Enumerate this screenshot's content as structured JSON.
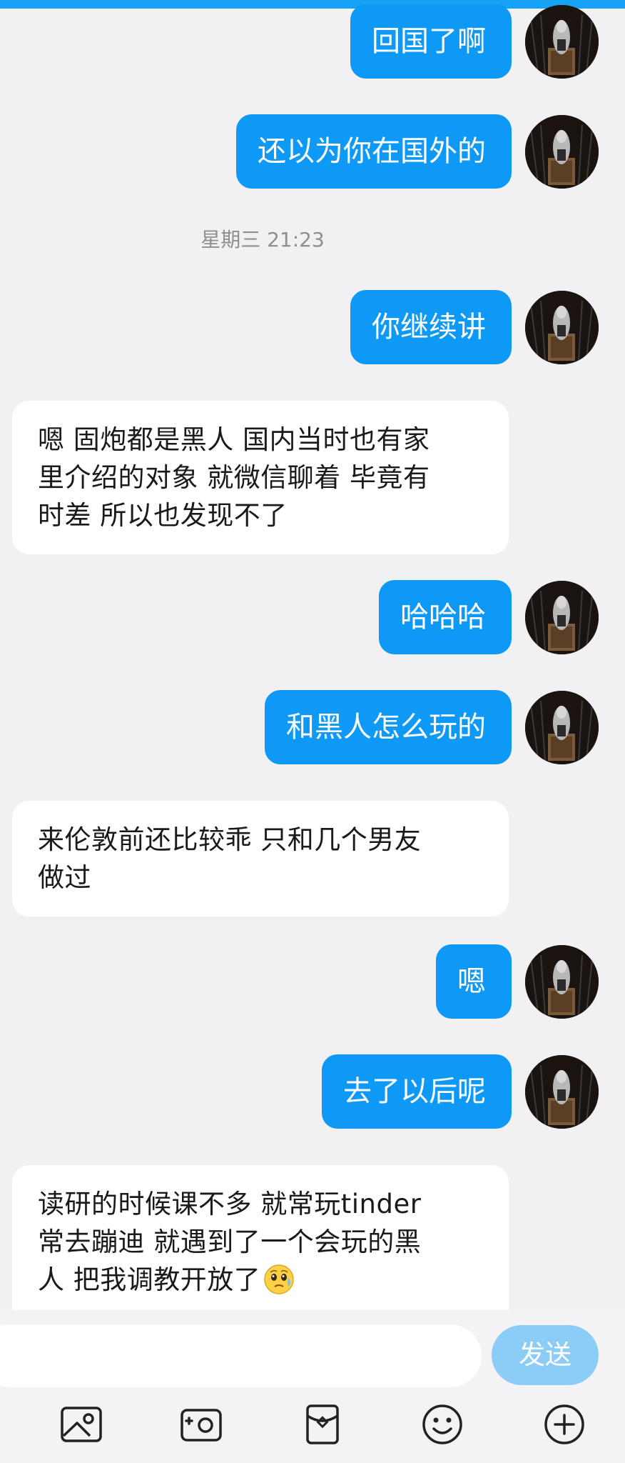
{
  "messages": [
    {
      "id": "m1",
      "direction": "out",
      "text": "回国了啊"
    },
    {
      "id": "m2",
      "direction": "out",
      "text": "还以为你在国外的"
    },
    {
      "id": "m3",
      "direction": "out",
      "text": "你继续讲"
    },
    {
      "id": "m4",
      "direction": "in",
      "lines": [
        "嗯 固炮都是黑人 国内当时也有家",
        "里介绍的对象 就微信聊着 毕竟有",
        "时差 所以也发现不了"
      ]
    },
    {
      "id": "m5",
      "direction": "out",
      "text": "哈哈哈"
    },
    {
      "id": "m6",
      "direction": "out",
      "text": "和黑人怎么玩的"
    },
    {
      "id": "m7",
      "direction": "in",
      "lines": [
        "来伦敦前还比较乖 只和几个男友",
        "做过"
      ]
    },
    {
      "id": "m8",
      "direction": "out",
      "text": "嗯"
    },
    {
      "id": "m9",
      "direction": "out",
      "text": "去了以后呢"
    },
    {
      "id": "m10",
      "direction": "in",
      "lines": [
        "读研的时候课不多 就常玩tinder",
        "常去蹦迪 就遇到了一个会玩的黑",
        "人 把我调教开放了"
      ],
      "trailing_emoji": "sweat-worried-face"
    }
  ],
  "timestamp": "星期三 21:23",
  "composer": {
    "value": "",
    "send_label": "发送"
  },
  "toolbar": {
    "items": [
      "image-icon",
      "camera-icon",
      "red-packet-icon",
      "emoji-icon",
      "plus-circle-icon"
    ]
  },
  "colors": {
    "outgoing_bubble": "#0f99f6",
    "incoming_bubble": "#ffffff",
    "send_button": "#8ccdf8",
    "background": "#f1f1f3"
  }
}
